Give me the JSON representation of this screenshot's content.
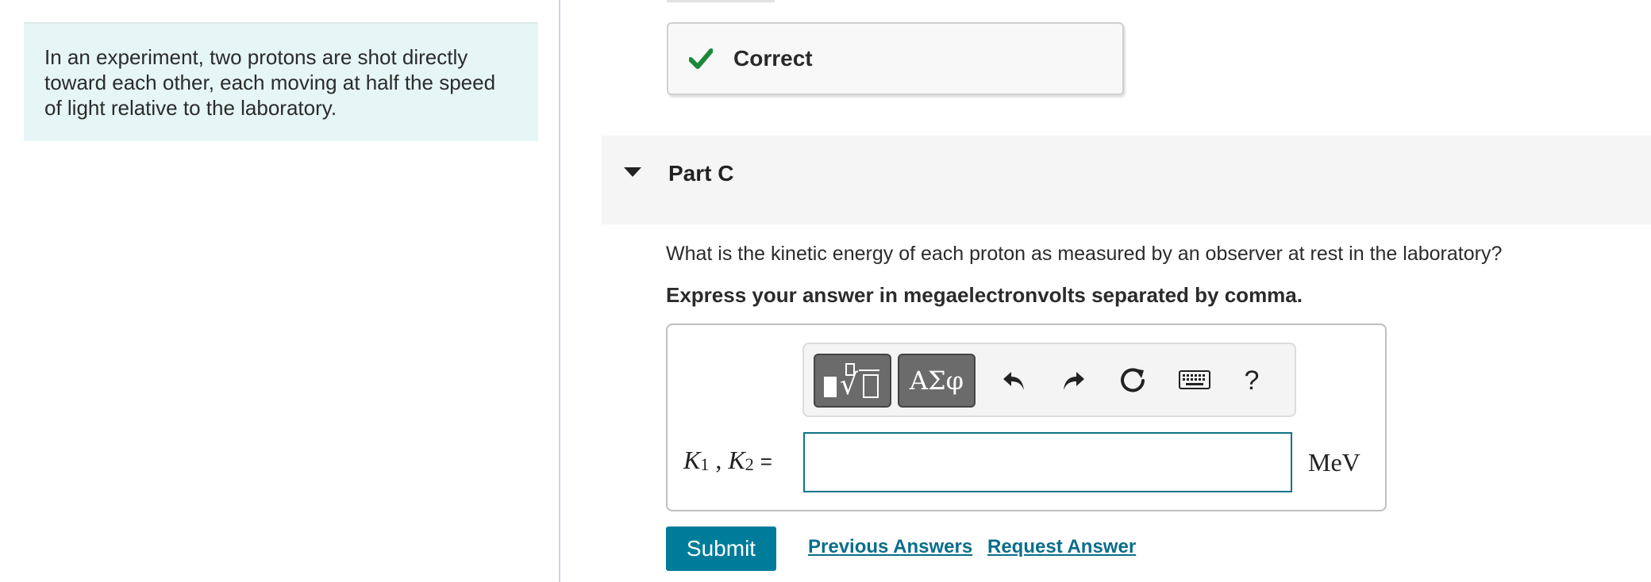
{
  "problem": {
    "intro": "In an experiment, two protons are shot directly toward each other, each moving at half the speed of light relative to the laboratory."
  },
  "feedback": {
    "status": "Correct",
    "color": "#1a8a3a"
  },
  "part": {
    "title": "Part C",
    "question": "What is the kinetic energy of each proton as measured by an observer at rest in the laboratory?",
    "instruction": "Express your answer in megaelectronvolts separated by comma."
  },
  "toolbar": {
    "templates_icon": "templates-icon",
    "symbols_label": "ΑΣφ",
    "undo_icon": "undo-icon",
    "redo_icon": "redo-icon",
    "reset_icon": "reset-icon",
    "keyboard_icon": "keyboard-icon",
    "help_label": "?"
  },
  "answer": {
    "var1": "K",
    "sub1": "1",
    "sep": " , ",
    "var2": "K",
    "sub2": "2",
    "equals": "=",
    "value": "",
    "unit": "MeV"
  },
  "actions": {
    "submit": "Submit",
    "previous_answers": "Previous Answers",
    "request_answer": "Request Answer"
  },
  "colors": {
    "accent": "#007c9b",
    "intro_bg": "#e6f5f5",
    "input_border": "#0f7387"
  }
}
